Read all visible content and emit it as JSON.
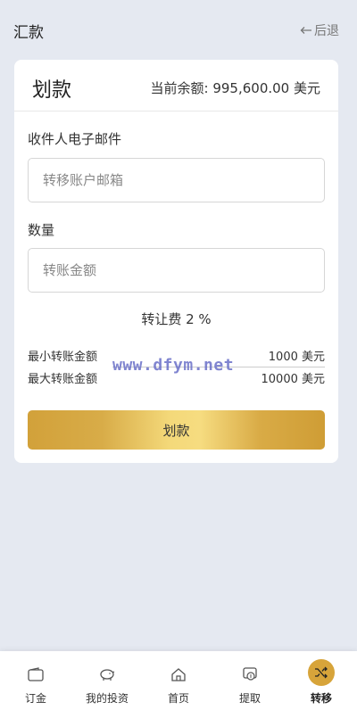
{
  "header": {
    "title": "汇款",
    "back_label": "后退"
  },
  "card": {
    "title": "划款",
    "balance_label": "当前余额:",
    "balance_value": "995,600.00 美元",
    "email_label": "收件人电子邮件",
    "email_placeholder": "转移账户邮箱",
    "amount_label": "数量",
    "amount_placeholder": "转账金额",
    "fee_text": "转让费 2 %",
    "min_label": "最小转账金额",
    "min_value": "1000 美元",
    "max_label": "最大转账金额",
    "max_value": "10000 美元",
    "submit_label": "划款"
  },
  "watermark": "www.dfym.net",
  "tabs": [
    {
      "label": "订金",
      "icon": "wallet-icon",
      "active": false
    },
    {
      "label": "我的投资",
      "icon": "piggy-bank-icon",
      "active": false
    },
    {
      "label": "首页",
      "icon": "home-icon",
      "active": false
    },
    {
      "label": "提取",
      "icon": "withdraw-icon",
      "active": false
    },
    {
      "label": "转移",
      "icon": "shuffle-icon",
      "active": true
    }
  ],
  "colors": {
    "accent": "#d7a43a",
    "background": "#e5e9f1",
    "watermark": "#6a70c8"
  }
}
